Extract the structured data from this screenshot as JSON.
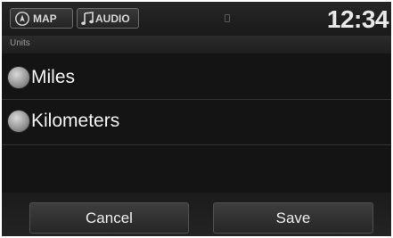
{
  "header": {
    "map_label": "MAP",
    "audio_label": "AUDIO",
    "clock": "12:34"
  },
  "section": {
    "title": "Units"
  },
  "options": [
    {
      "label": "Miles",
      "icon": "radio-button-icon"
    },
    {
      "label": "Kilometers",
      "icon": "radio-button-icon"
    }
  ],
  "footer": {
    "cancel_label": "Cancel",
    "save_label": "Save"
  },
  "colors": {
    "background": "#141414",
    "text": "#f1f1f1"
  }
}
